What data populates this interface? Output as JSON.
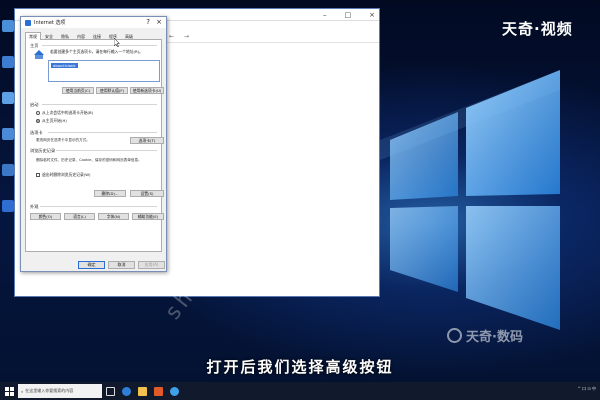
{
  "brand": {
    "top_text": "天奇·视频",
    "bottom_text": "天奇·数码",
    "diagonal_watermark": "shuma.tianqijun.com"
  },
  "subtitle": "打开后我们选择高级按钮",
  "colors": {
    "accent": "#2a6fd6",
    "wallpaper": "#05163f",
    "taskbar": "#101a2c",
    "selection": "#3a78d8"
  },
  "explorer": {
    "controls": [
      "–",
      "□",
      "×"
    ]
  },
  "dialog": {
    "title": "Internet 选项",
    "help": "?",
    "close": "×",
    "tabs": [
      "常规",
      "安全",
      "隐私",
      "内容",
      "连接",
      "程序",
      "高级"
    ],
    "active_tab": "常规",
    "home": {
      "section": "主页",
      "description": "若要创建多个主页选项卡，请在每行输入一个地址(R)。",
      "url": "about:blank",
      "buttons": [
        "使用当前页(C)",
        "使用默认值(F)",
        "使用新选项卡(U)"
      ]
    },
    "startup": {
      "section": "启动",
      "options": [
        {
          "label": "从上次会话中的选项卡开始(B)",
          "selected": false
        },
        {
          "label": "从主页开始(H)",
          "selected": true
        }
      ]
    },
    "tabs_section": {
      "section": "选项卡",
      "description": "更改网页在选项卡中显示的方式。",
      "button": "选项卡(T)"
    },
    "history": {
      "section": "浏览历史记录",
      "description": "删除临时文件、历史记录、Cookie、保存的密码和网页表单信息。",
      "checkbox": "退出时删除浏览历史记录(W)",
      "buttons": [
        "删除(D)...",
        "设置(S)"
      ]
    },
    "appearance": {
      "section": "外观",
      "buttons": [
        "颜色(O)",
        "语言(L)",
        "字体(N)",
        "辅助功能(E)"
      ]
    },
    "footer": {
      "ok": "确定",
      "cancel": "取消",
      "apply": "应用(A)"
    }
  },
  "taskbar": {
    "search_placeholder": "在这里输入你要搜索的内容",
    "icons": [
      "task-view-icon",
      "edge-icon",
      "explorer-icon",
      "store-icon",
      "ie-icon"
    ],
    "tray_text": "^ 口 ⊡ 中"
  }
}
